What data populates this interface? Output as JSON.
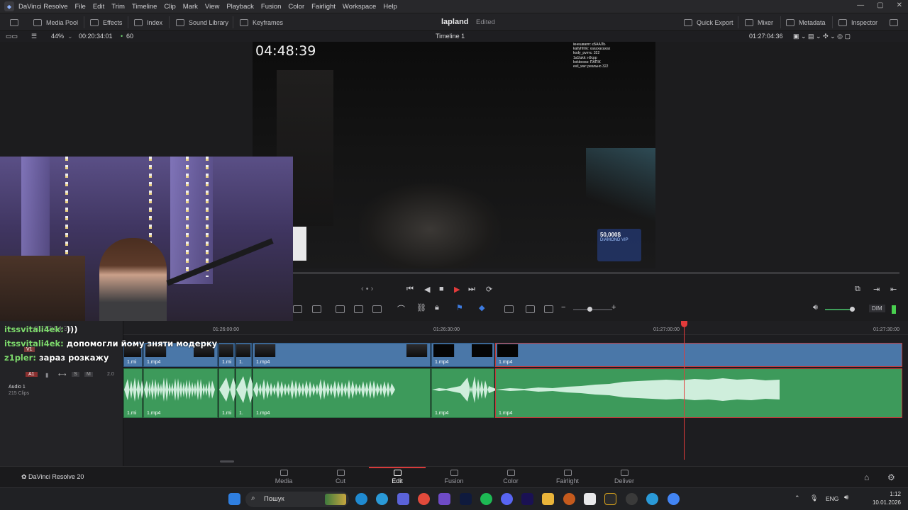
{
  "menubar": {
    "app_name": "DaVinci Resolve",
    "items": [
      "File",
      "Edit",
      "Trim",
      "Timeline",
      "Clip",
      "Mark",
      "View",
      "Playback",
      "Fusion",
      "Color",
      "Fairlight",
      "Workspace",
      "Help"
    ]
  },
  "toolbar": {
    "media_pool": "Media Pool",
    "effects": "Effects",
    "index": "Index",
    "sound_library": "Sound Library",
    "keyframes": "Keyframes",
    "project_title": "lapland",
    "project_status": "Edited",
    "quick_export": "Quick Export",
    "mixer": "Mixer",
    "metadata": "Metadata",
    "inspector": "Inspector"
  },
  "viewer_header": {
    "zoom": "44%",
    "source_timecode": "00:20:34:01",
    "fps": "60",
    "timeline_name": "Timeline 1",
    "timecode": "01:27:04:36"
  },
  "video": {
    "stream_timer": "04:48:39",
    "chat_lines": [
      "ікнешвапп: єБААЛЬ",
      "kallyhhhk: хахахахахах",
      "kody_pvrrrc: 322",
      "1a1lukk: н9срр",
      "kokbooss: ПАПІК",
      "evil_ww: реально 322"
    ],
    "badge_amount": "50,000$",
    "badge_text": "DIAMOND VIP"
  },
  "chat_overlay": [
    {
      "user": "itssvitali4ek:",
      "msg": ")))"
    },
    {
      "user": "itssvitali4ek:",
      "msg": "допомогли йому зняти модерку"
    },
    {
      "user": "z1pler:",
      "msg": "зараз розкажу"
    }
  ],
  "ruler": {
    "current": "01:27:04:36",
    "ticks": [
      "01:26:00:00",
      "01:26:30:00",
      "01:27:00:00",
      "01:27:30:00"
    ]
  },
  "tracks": {
    "video": {
      "id": "V1"
    },
    "audio": {
      "id": "A1",
      "name": "Audio 1",
      "clips_count": "215 Clips",
      "volume": "2.0",
      "solo": "S",
      "mute": "M"
    }
  },
  "clips": {
    "video": [
      "1.mi",
      "1.mp4",
      "1.mi",
      "1.",
      "1.mp4",
      "1.mp4",
      "1.mp4"
    ],
    "audio": [
      "1.mi",
      "1.mp4",
      "1.mi",
      "1.",
      "1.mp4",
      "1.mp4",
      "1.mp4"
    ]
  },
  "audio_controls": {
    "dim": "DIM"
  },
  "pagenav": {
    "brand": "DaVinci Resolve 20",
    "pages": [
      "Media",
      "Cut",
      "Edit",
      "Fusion",
      "Color",
      "Fairlight",
      "Deliver"
    ],
    "active": "Edit"
  },
  "taskbar": {
    "search_placeholder": "Пошук",
    "lang": "ENG",
    "time": "1:12",
    "date": "10.01.2026"
  },
  "colors": {
    "accent_red": "#e23b3b",
    "video_clip": "#4a77a8",
    "audio_clip": "#3d9a5b"
  }
}
